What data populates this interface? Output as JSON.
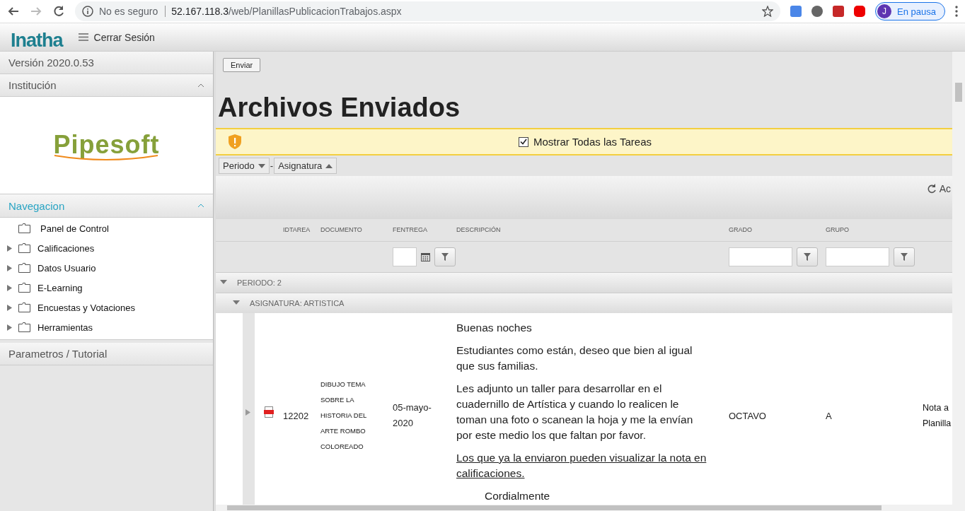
{
  "browser": {
    "security": "No es seguro",
    "url_host": "52.167.118.3",
    "url_path": "/web/PlanillasPublicacionTrabajos.aspx",
    "profile": {
      "initial": "J",
      "status": "En pausa"
    }
  },
  "app_header": {
    "logo": "Inatha",
    "menu_label": "Cerrar Sesión"
  },
  "sidebar": {
    "version": "Versión 2020.0.53",
    "institution": {
      "title": "Institución",
      "expanded": true,
      "logo": "Pipesoft"
    },
    "navigation": {
      "title": "Navegacion",
      "expanded": true,
      "items": [
        {
          "label": "Panel de Control",
          "expandable": false
        },
        {
          "label": "Calificaciones",
          "expandable": true
        },
        {
          "label": "Datos Usuario",
          "expandable": true
        },
        {
          "label": "E-Learning",
          "expandable": true
        },
        {
          "label": "Encuestas y Votaciones",
          "expandable": true
        },
        {
          "label": "Herramientas",
          "expandable": true
        }
      ]
    },
    "footer_section": "Parametros / Tutorial"
  },
  "main": {
    "send_button": "Enviar",
    "title": "Archivos Enviados",
    "notice": {
      "label": "Mostrar Todas las Tareas",
      "checked": true
    },
    "group_chips": [
      {
        "label": "Periodo",
        "ascending": false
      },
      {
        "label": "Asignatura",
        "ascending": true
      }
    ],
    "chip_separator": "-",
    "toolbar_action": "Ac",
    "columns": [
      "IDTAREA",
      "DOCUMENTO",
      "FENTREGA",
      "DESCRIPCIÓN",
      "GRADO",
      "GRUPO"
    ],
    "groups": [
      {
        "label": "PERIODO: 2",
        "expanded": true,
        "children": [
          {
            "label": "ASIGNATURA: ARTISTICA",
            "expanded": true,
            "rows": [
              {
                "idtarea": "12202",
                "documento": [
                  "DIBUJO TEMA",
                  "SOBRE LA",
                  "HISTORIA DEL",
                  "ARTE ROMBO",
                  "COLOREADO"
                ],
                "fentrega": "05-mayo-2020",
                "descripcion": [
                  {
                    "kind": "plain",
                    "text": "Buenas noches"
                  },
                  {
                    "kind": "plain",
                    "text": "Estudiantes como están, deseo que bien al igual que sus familias."
                  },
                  {
                    "kind": "plain",
                    "text": "Les adjunto un taller para desarrollar en el cuadernillo de Artística y cuando lo realicen le toman una foto o scanean la hoja y me la envían por este medio los que faltan por favor."
                  },
                  {
                    "kind": "underlined",
                    "text": "Los que ya la enviaron pueden visualizar la nota en calificaciones."
                  },
                  {
                    "kind": "indented",
                    "text": "Cordialmente"
                  }
                ],
                "grado": "OCTAVO",
                "grupo": "A",
                "column_8": [
                  "Nota a",
                  "Planilla"
                ]
              }
            ]
          }
        ]
      }
    ]
  }
}
